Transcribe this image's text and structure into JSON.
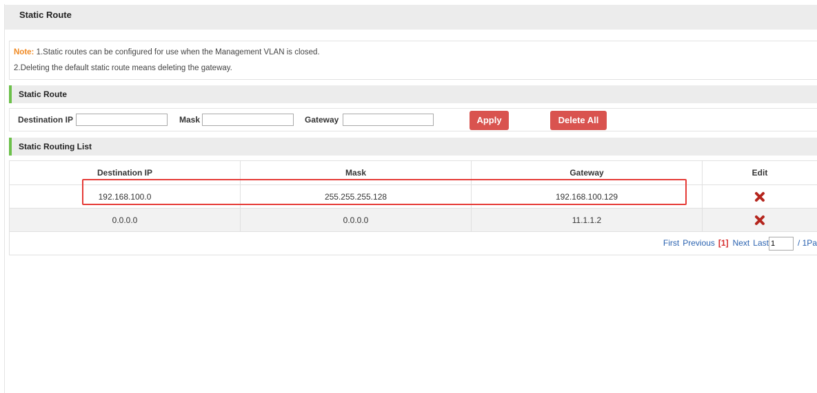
{
  "page_title": "Static Route",
  "note": {
    "label": "Note:",
    "line1": "1.Static routes can be configured for use when the Management VLAN is closed.",
    "line2": "2.Deleting the default static route means deleting the gateway."
  },
  "static_route_section": {
    "title": "Static Route",
    "dest_ip_label": "Destination IP",
    "dest_ip_value": "",
    "mask_label": "Mask",
    "mask_value": "",
    "gateway_label": "Gateway",
    "gateway_value": "",
    "apply_label": "Apply",
    "delete_all_label": "Delete All"
  },
  "routing_list": {
    "title": "Static Routing List",
    "columns": [
      "Destination IP",
      "Mask",
      "Gateway",
      "Edit"
    ],
    "rows": [
      {
        "dest_ip": "192.168.100.0",
        "mask": "255.255.255.128",
        "gateway": "192.168.100.129",
        "edit_icon": "delete-x-icon"
      },
      {
        "dest_ip": "0.0.0.0",
        "mask": "0.0.0.0",
        "gateway": "11.1.1.2",
        "edit_icon": "delete-x-icon"
      }
    ]
  },
  "pagination": {
    "first": "First",
    "previous": "Previous",
    "current": "[1]",
    "next": "Next",
    "last": "Last",
    "page_input": "1",
    "total": "/ 1Pa"
  },
  "colors": {
    "button": "#d9534f",
    "section_accent": "#6cc04a",
    "note_label": "#f08a24",
    "link": "#2a62b0",
    "highlight_box": "#e53935"
  }
}
